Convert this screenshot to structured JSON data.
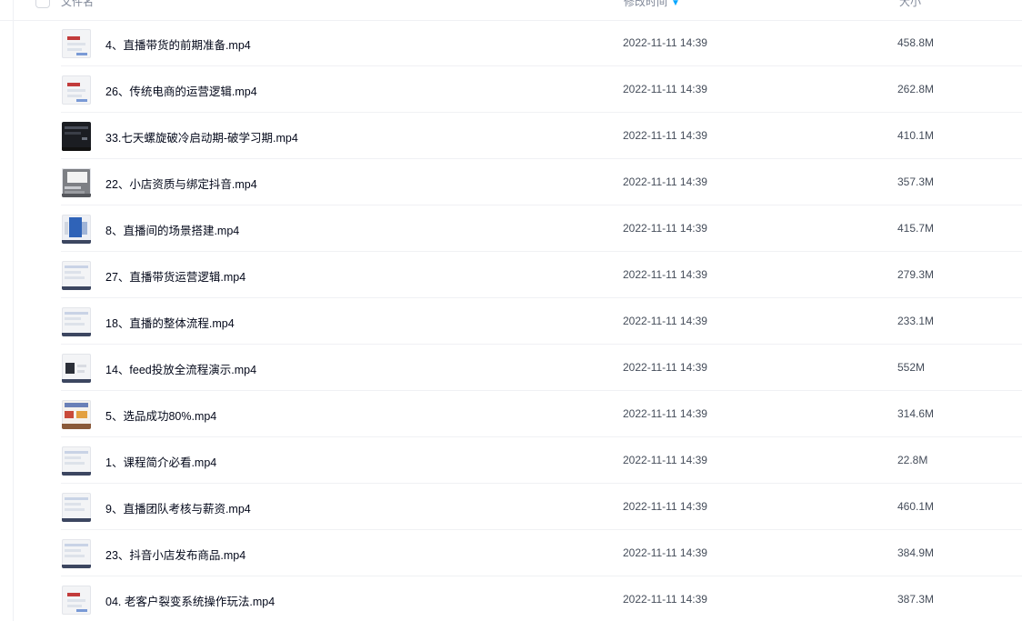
{
  "header": {
    "name_label": "文件名",
    "time_label": "修改时间",
    "size_label": "大小",
    "sort_icon": "sort-down-icon",
    "sort_color": "#06a7ff"
  },
  "files": [
    {
      "name": "4、直播带货的前期准备.mp4",
      "time": "2022-11-11 14:39",
      "size": "458.8M",
      "thumb": "doc"
    },
    {
      "name": "26、传统电商的运营逻辑.mp4",
      "time": "2022-11-11 14:39",
      "size": "262.8M",
      "thumb": "doc"
    },
    {
      "name": "33.七天螺旋破冷启动期-破学习期.mp4",
      "time": "2022-11-11 14:39",
      "size": "410.1M",
      "thumb": "dark"
    },
    {
      "name": "22、小店资质与绑定抖音.mp4",
      "time": "2022-11-11 14:39",
      "size": "357.3M",
      "thumb": "gray"
    },
    {
      "name": "8、直播间的场景搭建.mp4",
      "time": "2022-11-11 14:39",
      "size": "415.7M",
      "thumb": "photo"
    },
    {
      "name": "27、直播带货运营逻辑.mp4",
      "time": "2022-11-11 14:39",
      "size": "279.3M",
      "thumb": "plain"
    },
    {
      "name": "18、直播的整体流程.mp4",
      "time": "2022-11-11 14:39",
      "size": "233.1M",
      "thumb": "plain"
    },
    {
      "name": "14、feed投放全流程演示.mp4",
      "time": "2022-11-11 14:39",
      "size": "552M",
      "thumb": "dark-small"
    },
    {
      "name": "5、选品成功80%.mp4",
      "time": "2022-11-11 14:39",
      "size": "314.6M",
      "thumb": "colorful"
    },
    {
      "name": "1、课程简介必看.mp4",
      "time": "2022-11-11 14:39",
      "size": "22.8M",
      "thumb": "plain"
    },
    {
      "name": "9、直播团队考核与薪资.mp4",
      "time": "2022-11-11 14:39",
      "size": "460.1M",
      "thumb": "plain"
    },
    {
      "name": "23、抖音小店发布商品.mp4",
      "time": "2022-11-11 14:39",
      "size": "384.9M",
      "thumb": "plain"
    },
    {
      "name": "04. 老客户裂变系统操作玩法.mp4",
      "time": "2022-11-11 14:39",
      "size": "387.3M",
      "thumb": "doc"
    }
  ]
}
